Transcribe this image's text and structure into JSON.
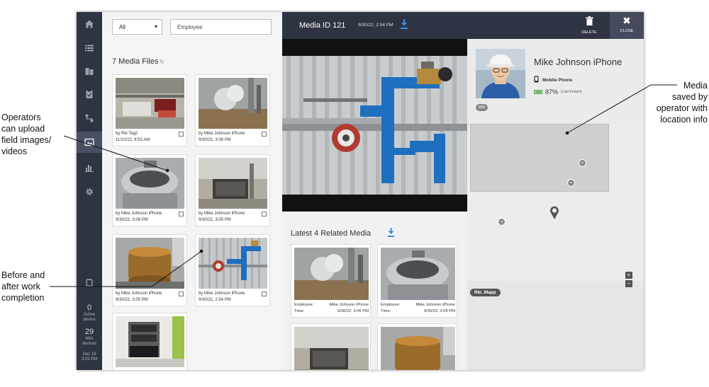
{
  "annotations": {
    "upload_lines": [
      "Operators",
      "can upload",
      "field images/",
      "videos"
    ],
    "before_after_lines": [
      "Before and",
      "after work",
      "completion"
    ],
    "saved_lines": [
      "Media",
      "saved by",
      "operator with",
      "location info"
    ]
  },
  "sidebar": {
    "icons": [
      "home-icon",
      "list-icon",
      "devices-icon",
      "clipboard-icon",
      "route-icon",
      "image-icon",
      "bar-chart-icon",
      "gear-icon",
      "tablet-icon"
    ],
    "active_device_count": "0",
    "active_device_label_1": "Active",
    "active_device_label_2": "device",
    "mia_count": "29",
    "mia_label_1": "MIA",
    "mia_label_2": "devices",
    "date": "Dec 19",
    "time": "3:03 PM"
  },
  "media_files": {
    "filter_value": "All",
    "search_value": "Employee",
    "title": "7 Media Files",
    "items": [
      {
        "by": "by Rki Tag2",
        "time": "11/10/22, 8:53 AM"
      },
      {
        "by": "by Mike Johnson iPhone",
        "time": "9/30/22, 3:06 PM"
      },
      {
        "by": "by Mike Johnson iPhone",
        "time": "9/30/22, 3:06 PM"
      },
      {
        "by": "by Mike Johnson iPhone",
        "time": "9/30/22, 3:05 PM"
      },
      {
        "by": "by Mike Johnson iPhone",
        "time": "9/30/22, 3:05 PM"
      },
      {
        "by": "by Mike Johnson iPhone",
        "time": "9/30/22, 2:54 PM"
      },
      {
        "by": "",
        "time": ""
      }
    ]
  },
  "viewer": {
    "title": "Media ID 121",
    "date": "9/30/22, 2:54 PM",
    "delete_label": "DELETE",
    "close_label": "CLOSE",
    "related_title": "Latest 4 Related Media",
    "related": [
      {
        "employee_label": "Employee:",
        "employee": "Mike Johnson iPhone",
        "time_label": "Time:",
        "time": "9/30/22, 3:06 PM"
      },
      {
        "employee_label": "Employee:",
        "employee": "Mike Johnson iPhone",
        "time_label": "Time:",
        "time": "9/30/22, 3:06 PM"
      },
      {
        "employee_label": "",
        "employee": "",
        "time_label": "",
        "time": ""
      },
      {
        "employee_label": "",
        "employee": "",
        "time_label": "",
        "time": ""
      }
    ]
  },
  "profile": {
    "name": "Mike Johnson iPhone",
    "device_type": "Mobile Phone",
    "battery": "87%",
    "battery_note": "(Last Known)",
    "tag": "MIA"
  },
  "map": {
    "dots": [
      "LW",
      "LW",
      "LW"
    ],
    "area_label": "Rki_Mapp",
    "zoom_in": "+",
    "zoom_out": "−"
  }
}
